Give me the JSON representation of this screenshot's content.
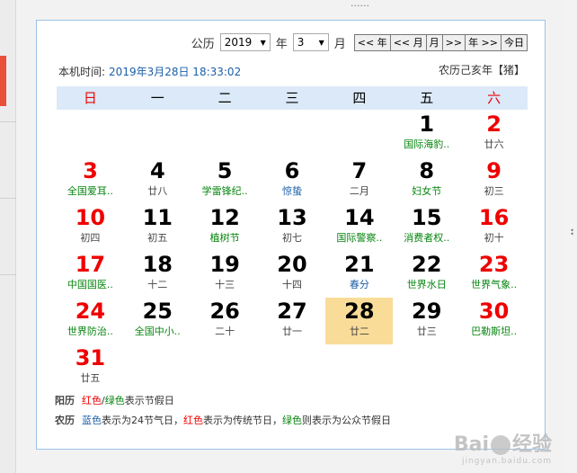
{
  "background": {
    "top_fragment": "......"
  },
  "calendar": {
    "year_label": "公历",
    "year_value": "2019",
    "year_suffix": "年",
    "month_value": "3",
    "month_suffix": "月",
    "nav": [
      "<< 年",
      "<< 月",
      "月",
      ">>",
      "年 >>",
      "今日"
    ],
    "local_time_label": "本机时间:",
    "local_time_value": "2019年3月28日 18:33:02",
    "lunar_year": "农历己亥年【猪】",
    "weekdays": [
      "日",
      "一",
      "二",
      "三",
      "四",
      "五",
      "六"
    ],
    "weeks": [
      [
        {
          "d": "",
          "s": "",
          "dc": "",
          "sc": ""
        },
        {
          "d": "",
          "s": "",
          "dc": "",
          "sc": ""
        },
        {
          "d": "",
          "s": "",
          "dc": "",
          "sc": ""
        },
        {
          "d": "",
          "s": "",
          "dc": "",
          "sc": ""
        },
        {
          "d": "",
          "s": "",
          "dc": "",
          "sc": ""
        },
        {
          "d": "1",
          "s": "国际海豹..",
          "dc": "black",
          "sc": "green"
        },
        {
          "d": "2",
          "s": "廿六",
          "dc": "red",
          "sc": "gray"
        }
      ],
      [
        {
          "d": "3",
          "s": "全国爱耳..",
          "dc": "red",
          "sc": "green"
        },
        {
          "d": "4",
          "s": "廿八",
          "dc": "black",
          "sc": "gray"
        },
        {
          "d": "5",
          "s": "学雷锋纪..",
          "dc": "black",
          "sc": "green"
        },
        {
          "d": "6",
          "s": "惊蛰",
          "dc": "black",
          "sc": "blue"
        },
        {
          "d": "7",
          "s": "二月",
          "dc": "black",
          "sc": "gray"
        },
        {
          "d": "8",
          "s": "妇女节",
          "dc": "black",
          "sc": "green"
        },
        {
          "d": "9",
          "s": "初三",
          "dc": "red",
          "sc": "gray"
        }
      ],
      [
        {
          "d": "10",
          "s": "初四",
          "dc": "red",
          "sc": "gray"
        },
        {
          "d": "11",
          "s": "初五",
          "dc": "black",
          "sc": "gray"
        },
        {
          "d": "12",
          "s": "植树节",
          "dc": "black",
          "sc": "green"
        },
        {
          "d": "13",
          "s": "初七",
          "dc": "black",
          "sc": "gray"
        },
        {
          "d": "14",
          "s": "国际警察..",
          "dc": "black",
          "sc": "green"
        },
        {
          "d": "15",
          "s": "消费者权..",
          "dc": "black",
          "sc": "green"
        },
        {
          "d": "16",
          "s": "初十",
          "dc": "red",
          "sc": "gray"
        }
      ],
      [
        {
          "d": "17",
          "s": "中国国医..",
          "dc": "red",
          "sc": "green"
        },
        {
          "d": "18",
          "s": "十二",
          "dc": "black",
          "sc": "gray"
        },
        {
          "d": "19",
          "s": "十三",
          "dc": "black",
          "sc": "gray"
        },
        {
          "d": "20",
          "s": "十四",
          "dc": "black",
          "sc": "gray"
        },
        {
          "d": "21",
          "s": "春分",
          "dc": "black",
          "sc": "blue"
        },
        {
          "d": "22",
          "s": "世界水日",
          "dc": "black",
          "sc": "green"
        },
        {
          "d": "23",
          "s": "世界气象..",
          "dc": "red",
          "sc": "green"
        }
      ],
      [
        {
          "d": "24",
          "s": "世界防治..",
          "dc": "red",
          "sc": "green"
        },
        {
          "d": "25",
          "s": "全国中小..",
          "dc": "black",
          "sc": "green"
        },
        {
          "d": "26",
          "s": "二十",
          "dc": "black",
          "sc": "gray"
        },
        {
          "d": "27",
          "s": "廿一",
          "dc": "black",
          "sc": "gray"
        },
        {
          "d": "28",
          "s": "廿二",
          "dc": "black",
          "sc": "gray",
          "today": true
        },
        {
          "d": "29",
          "s": "廿三",
          "dc": "black",
          "sc": "gray"
        },
        {
          "d": "30",
          "s": "巴勒斯坦..",
          "dc": "red",
          "sc": "green"
        }
      ],
      [
        {
          "d": "31",
          "s": "廿五",
          "dc": "red",
          "sc": "gray"
        },
        {
          "d": "",
          "s": "",
          "dc": "",
          "sc": ""
        },
        {
          "d": "",
          "s": "",
          "dc": "",
          "sc": ""
        },
        {
          "d": "",
          "s": "",
          "dc": "",
          "sc": ""
        },
        {
          "d": "",
          "s": "",
          "dc": "",
          "sc": ""
        },
        {
          "d": "",
          "s": "",
          "dc": "",
          "sc": ""
        },
        {
          "d": "",
          "s": "",
          "dc": "",
          "sc": ""
        }
      ]
    ],
    "legend": {
      "solar_label": "阳历",
      "solar_red": "红色",
      "solar_sep": "/",
      "solar_green": "绿色",
      "solar_text": "表示节假日",
      "lunar_label": "农历",
      "lunar_blue": "蓝色",
      "lunar_text1": "表示为24节气日，",
      "lunar_red": "红色",
      "lunar_text2": "表示为传统节日，",
      "lunar_green": "绿色",
      "lunar_text3": "则表示为公众节假日"
    },
    "colors": {
      "holiday_red": "#e00000",
      "holiday_green": "#07840e",
      "solar_term_blue": "#1c5fa8",
      "today_bg": "#fadc99",
      "header_bg": "#dbe9f8"
    }
  },
  "watermark": {
    "text_a": "Bai",
    "text_b": "经验",
    "text_small": "jingyan.baidu.com"
  }
}
